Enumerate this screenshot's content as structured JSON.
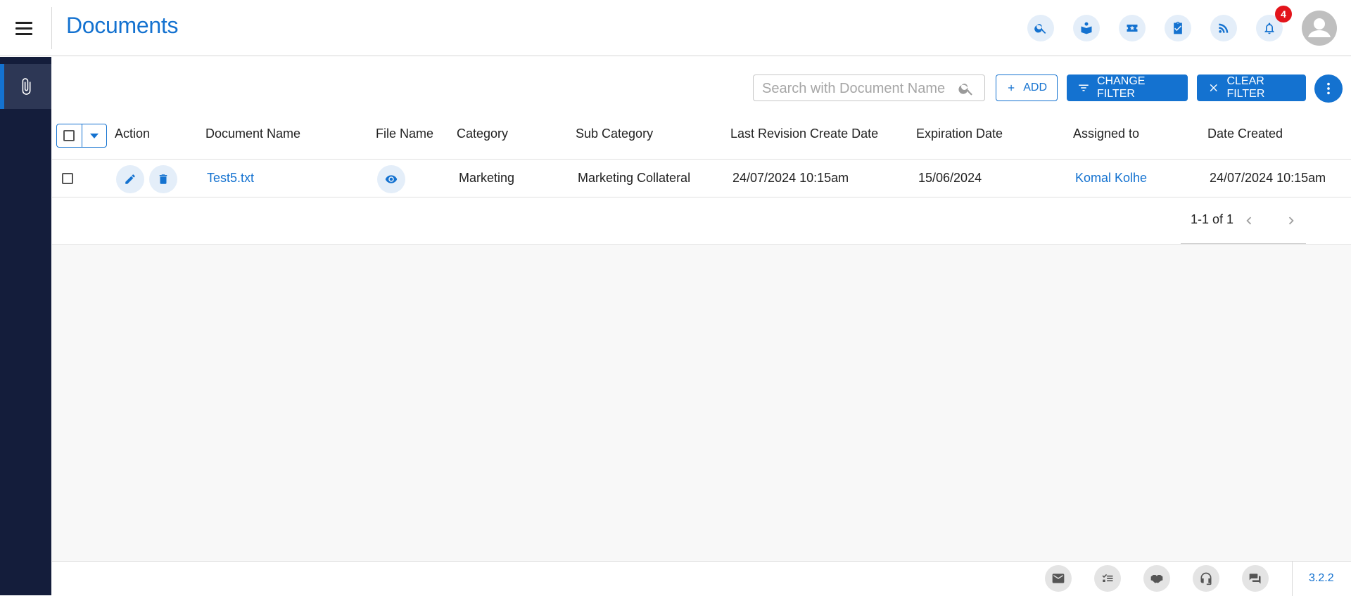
{
  "header": {
    "title": "Documents",
    "icons": [
      "search-icon",
      "book-reader-icon",
      "ticket-icon",
      "clipboard-check-icon",
      "rss-feed-icon",
      "bell-icon"
    ],
    "notification_count": "4"
  },
  "sidebar": {
    "items": [
      {
        "icon": "paperclip-icon",
        "active": true
      }
    ]
  },
  "toolbar": {
    "search_placeholder": "Search with Document Name",
    "add_label": "ADD",
    "change_filter_label": "CHANGE FILTER",
    "clear_filter_label": "CLEAR FILTER"
  },
  "table": {
    "columns": [
      "Action",
      "Document Name",
      "File Name",
      "Category",
      "Sub Category",
      "Last Revision Create Date",
      "Expiration Date",
      "Assigned to",
      "Date Created"
    ],
    "rows": [
      {
        "document_name": "Test5.txt",
        "category": "Marketing",
        "sub_category": "Marketing Collateral",
        "last_revision": "24/07/2024 10:15am",
        "expiration": "15/06/2024",
        "assigned_to": "Komal Kolhe",
        "date_created": "24/07/2024 10:15am"
      }
    ]
  },
  "pagination": {
    "text": "1-1 of 1"
  },
  "footer": {
    "icons": [
      "mail-icon",
      "checklist-icon",
      "handshake-icon",
      "headset-icon",
      "chat-icon"
    ],
    "version": "3.2.2"
  },
  "colors": {
    "accent": "#1472d0",
    "sidebar": "#141d3b",
    "badge": "#e3141b"
  }
}
